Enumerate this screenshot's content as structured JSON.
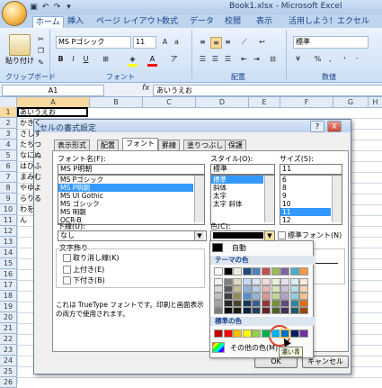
{
  "window": {
    "title": "Book1.xlsx - Microsoft Excel"
  },
  "ribbon": {
    "tabs": [
      "ホーム",
      "挿入",
      "ページ レイアウト",
      "数式",
      "データ",
      "校閲",
      "表示",
      "活用しよう！エクセル"
    ],
    "paste_label": "貼り付け",
    "font_name": "MS Pゴシック",
    "font_size": "11",
    "number_format": "標準",
    "groups": {
      "clipboard": "クリップボード",
      "font": "フォント",
      "alignment": "配置",
      "number": "数値"
    }
  },
  "formula_bar": {
    "name_box": "A1",
    "fx": "fx",
    "content": "あいうえお"
  },
  "sheet": {
    "columns": [
      "A",
      "B",
      "C",
      "D",
      "E",
      "F",
      "G",
      "H"
    ],
    "rows": [
      "1",
      "2",
      "3",
      "4",
      "5",
      "6",
      "7",
      "8",
      "9",
      "10",
      "11",
      "12",
      "13",
      "14",
      "15",
      "16",
      "17",
      "18",
      "19",
      "20",
      "21",
      "22",
      "23",
      "24",
      "25",
      "26"
    ],
    "cells": [
      "あいうえお",
      "かきく",
      "さしす",
      "たちつ",
      "なにぬ",
      "はひふ",
      "まみむ",
      "やゆよ",
      "らりる",
      "わを",
      "ん"
    ]
  },
  "dialog": {
    "title": "セルの書式設定",
    "help": "?",
    "close": "X",
    "tabs": [
      "表示形式",
      "配置",
      "フォント",
      "罫線",
      "塗りつぶし",
      "保護"
    ],
    "active_tab": "フォント",
    "font": {
      "label": "フォント名(F):",
      "value": "MS P明朝",
      "items": [
        "MS Pゴシック",
        "MS P明朝",
        "MS UI Gothic",
        "MS ゴシック",
        "MS 明朝",
        "OCR-B"
      ],
      "selected": "MS P明朝"
    },
    "style": {
      "label": "スタイル(O):",
      "value": "標準",
      "items": [
        "標準",
        "斜体",
        "太字",
        "太字 斜体"
      ],
      "selected": "標準"
    },
    "size": {
      "label": "サイズ(S):",
      "value": "11",
      "items": [
        "6",
        "8",
        "9",
        "10",
        "11",
        "12"
      ],
      "selected": "11"
    },
    "underline": {
      "label": "下線(U):",
      "value": "なし"
    },
    "color": {
      "label": "色(C):",
      "normal_font_label": "標準フォント(N)"
    },
    "effects": {
      "label": "文字飾り",
      "items": [
        "取り消し線(K)",
        "上付き(E)",
        "下付き(B)"
      ]
    },
    "note": "これは TrueType フォントです。印刷と画面表示の両方で使用されます。",
    "ok": "OK",
    "cancel": "キャンセル"
  },
  "color_popup": {
    "auto": "自動",
    "theme_header": "テーマの色",
    "standard_header": "標準の色",
    "more_colors": "その他の色(M)...",
    "tooltip": "濃い青",
    "theme_top": [
      "#ffffff",
      "#000000",
      "#eeece1",
      "#1f497d",
      "#4f81bd",
      "#c0504d",
      "#9bbb59",
      "#8064a2",
      "#4bacc6",
      "#f79646"
    ],
    "theme_shades": [
      [
        "#f2f2f2",
        "#7f7f7f",
        "#ddd9c3",
        "#c6d9f0",
        "#dbe5f1",
        "#f2dcdb",
        "#ebf1dd",
        "#e5e0ec",
        "#dbeef3",
        "#fdeada"
      ],
      [
        "#d8d8d8",
        "#595959",
        "#c4bd97",
        "#8db3e2",
        "#b8cce4",
        "#e5b9b7",
        "#d7e3bc",
        "#ccc1d9",
        "#b7dde8",
        "#fbd5b5"
      ],
      [
        "#bfbfbf",
        "#3f3f3f",
        "#938953",
        "#548dd4",
        "#95b3d7",
        "#d99694",
        "#c3d69b",
        "#b2a2c7",
        "#92cddc",
        "#fac08f"
      ],
      [
        "#a5a5a5",
        "#262626",
        "#494429",
        "#17365d",
        "#366092",
        "#953734",
        "#76923c",
        "#5f497a",
        "#31859b",
        "#e36c09"
      ],
      [
        "#7f7f7f",
        "#0c0c0c",
        "#1d1b10",
        "#0f243e",
        "#244061",
        "#632423",
        "#4f6128",
        "#3f3151",
        "#205867",
        "#974806"
      ]
    ],
    "standard": [
      "#c00000",
      "#ff0000",
      "#ffc000",
      "#ffff00",
      "#92d050",
      "#00b050",
      "#00b0f0",
      "#0070c0",
      "#002060",
      "#7030a0"
    ]
  }
}
